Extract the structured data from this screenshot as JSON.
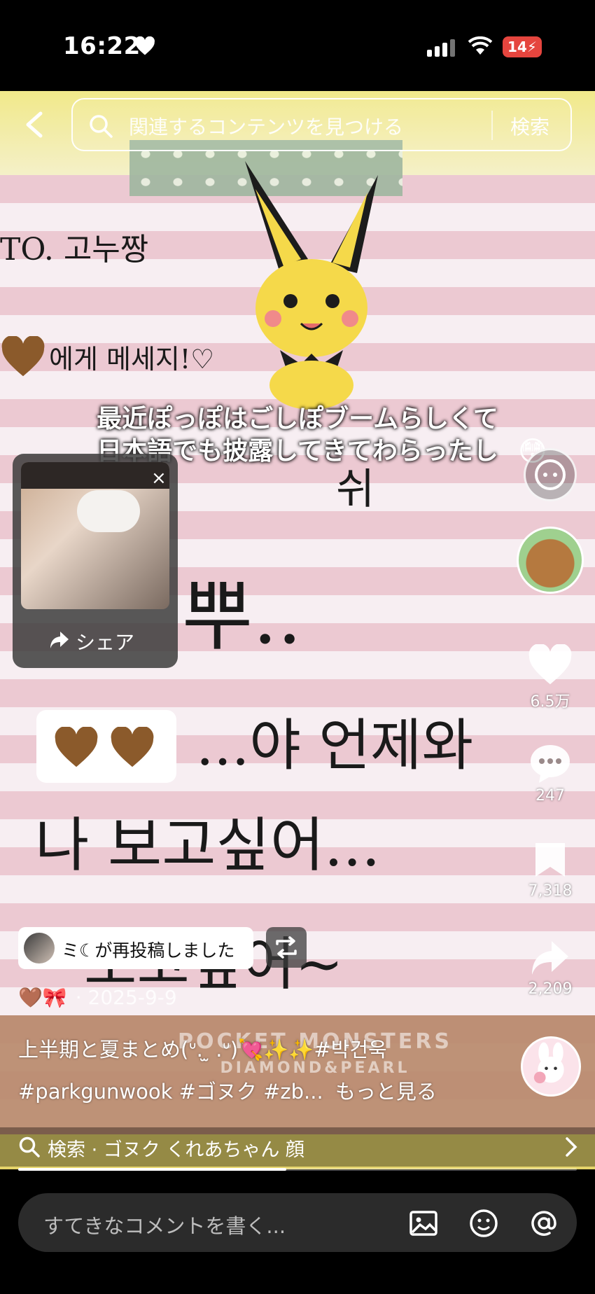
{
  "status": {
    "time": "16:22",
    "battery": "14"
  },
  "search": {
    "placeholder": "関連するコンテンツを見つける",
    "button": "検索"
  },
  "video": {
    "caption_line1": "最近ぽっぽはごしぽブームらしくて",
    "caption_line2": "日本語でも披露してきてわらったし",
    "handwriting": [
      "TO. 고누짱",
      "에게  메세지!♡",
      "쉬",
      "뿌..",
      "...야  언제와",
      "나 보고싶어...",
      "보고싶어~"
    ],
    "printed_brand": "POCKET MONSTERS",
    "printed_brand_sub": "DIAMOND&PEARL"
  },
  "mini_card": {
    "share_label": "シェア",
    "close": "×"
  },
  "rail": {
    "likes": "6.5万",
    "comments": "247",
    "saves": "7,318",
    "shares": "2,209"
  },
  "repost": {
    "text": "ミ☾が再投稿しました"
  },
  "meta": {
    "emojis": "🤎🎀",
    "date": "· 2025-9-9"
  },
  "description": {
    "line1": "上半期と夏まとめ(ᐡ. ̫ .ᐡ)💘✨✨#박건욱",
    "line2": "#parkgunwook #ゴヌク #zb...",
    "more": "もっと見る"
  },
  "suggestion": {
    "text": "検索 · ゴヌク くれあちゃん 顔"
  },
  "progress": {
    "fraction": 0.48
  },
  "comment_bar": {
    "placeholder": "すてきなコメントを書く..."
  },
  "colors": {
    "battery": "#e5453e",
    "brown_heart": "#8b5a2b"
  }
}
